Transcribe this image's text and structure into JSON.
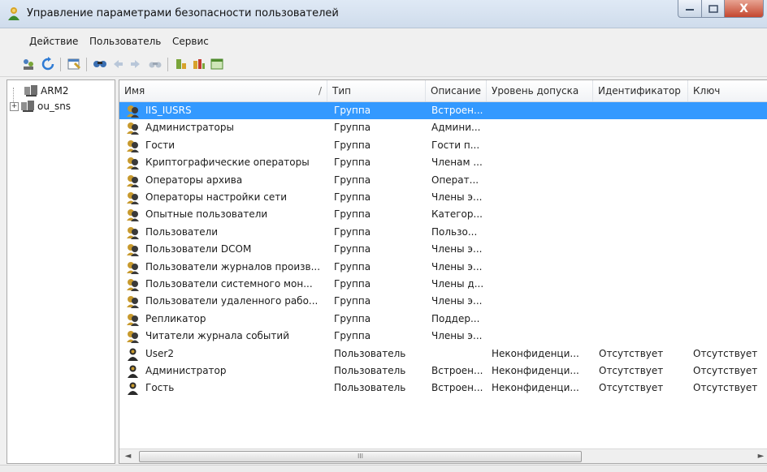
{
  "window": {
    "title": "Управление параметрами безопасности пользователей",
    "close_glyph": "X"
  },
  "menu": [
    "Действие",
    "Пользователь",
    "Сервис"
  ],
  "toolbar_icons": [
    "users-icon",
    "refresh-icon",
    "properties-icon",
    "search-icon",
    "arrow-left-icon",
    "arrow-right-icon",
    "binoculars-icon",
    "user-access-icon",
    "group-access-icon",
    "window-icon"
  ],
  "tree": [
    {
      "label": "ARM2",
      "expandable": false
    },
    {
      "label": "ou_sns",
      "expandable": true,
      "expander": "+"
    }
  ],
  "list": {
    "columns": [
      "Имя",
      "Тип",
      "Описание",
      "Уровень допуска",
      "Идентификатор",
      "Ключ"
    ],
    "sort_indicator": "/",
    "rows": [
      {
        "name": "IIS_IUSRS",
        "type": "Группа",
        "desc": "Встроен...",
        "level": "",
        "ident": "",
        "key": "",
        "kind": "group",
        "selected": true
      },
      {
        "name": "Администраторы",
        "type": "Группа",
        "desc": "Админи...",
        "level": "",
        "ident": "",
        "key": "",
        "kind": "group"
      },
      {
        "name": "Гости",
        "type": "Группа",
        "desc": "Гости п...",
        "level": "",
        "ident": "",
        "key": "",
        "kind": "group"
      },
      {
        "name": "Криптографические операторы",
        "type": "Группа",
        "desc": "Членам ...",
        "level": "",
        "ident": "",
        "key": "",
        "kind": "group"
      },
      {
        "name": "Операторы архива",
        "type": "Группа",
        "desc": "Операт...",
        "level": "",
        "ident": "",
        "key": "",
        "kind": "group"
      },
      {
        "name": "Операторы настройки сети",
        "type": "Группа",
        "desc": "Члены э...",
        "level": "",
        "ident": "",
        "key": "",
        "kind": "group"
      },
      {
        "name": "Опытные пользователи",
        "type": "Группа",
        "desc": "Категор...",
        "level": "",
        "ident": "",
        "key": "",
        "kind": "group"
      },
      {
        "name": "Пользователи",
        "type": "Группа",
        "desc": "Пользо...",
        "level": "",
        "ident": "",
        "key": "",
        "kind": "group"
      },
      {
        "name": "Пользователи DCOM",
        "type": "Группа",
        "desc": "Члены э...",
        "level": "",
        "ident": "",
        "key": "",
        "kind": "group"
      },
      {
        "name": "Пользователи журналов произв...",
        "type": "Группа",
        "desc": "Члены э...",
        "level": "",
        "ident": "",
        "key": "",
        "kind": "group"
      },
      {
        "name": "Пользователи системного мон...",
        "type": "Группа",
        "desc": "Члены д...",
        "level": "",
        "ident": "",
        "key": "",
        "kind": "group"
      },
      {
        "name": "Пользователи удаленного рабо...",
        "type": "Группа",
        "desc": "Члены э...",
        "level": "",
        "ident": "",
        "key": "",
        "kind": "group"
      },
      {
        "name": "Репликатор",
        "type": "Группа",
        "desc": "Поддер...",
        "level": "",
        "ident": "",
        "key": "",
        "kind": "group"
      },
      {
        "name": "Читатели журнала событий",
        "type": "Группа",
        "desc": "Члены э...",
        "level": "",
        "ident": "",
        "key": "",
        "kind": "group"
      },
      {
        "name": "User2",
        "type": "Пользователь",
        "desc": "",
        "level": "Неконфиденци...",
        "ident": "Отсутствует",
        "key": "Отсутствует",
        "kind": "user"
      },
      {
        "name": "Администратор",
        "type": "Пользователь",
        "desc": "Встроен...",
        "level": "Неконфиденци...",
        "ident": "Отсутствует",
        "key": "Отсутствует",
        "kind": "user"
      },
      {
        "name": "Гость",
        "type": "Пользователь",
        "desc": "Встроен...",
        "level": "Неконфиденци...",
        "ident": "Отсутствует",
        "key": "Отсутствует",
        "kind": "user"
      }
    ]
  },
  "scrollbar": {
    "left_arrow": "◄",
    "right_arrow": "►",
    "grip": "III"
  },
  "colors": {
    "selection": "#3399ff",
    "group_icon": "#c89a2e",
    "user_icon": "#2a2a2a"
  }
}
